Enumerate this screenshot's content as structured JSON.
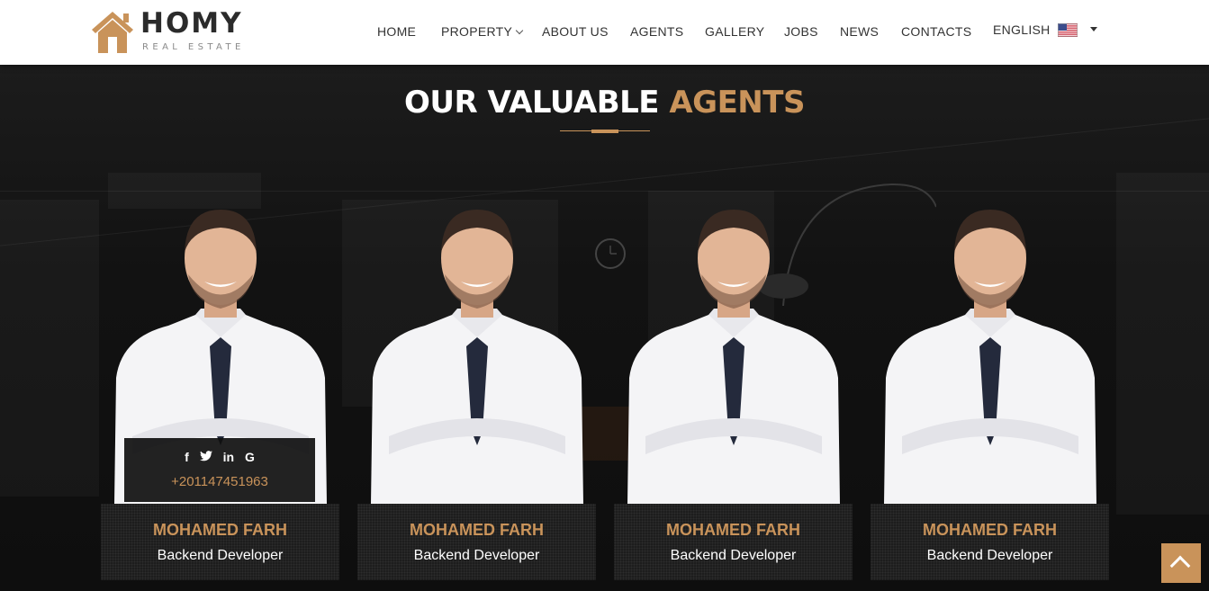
{
  "brand": {
    "name": "HOMY",
    "tagline": "REAL ESTATE",
    "colors": {
      "accent": "#c9935a",
      "dark": "#2b2b2b",
      "background": "#141414"
    }
  },
  "nav": {
    "items": [
      {
        "label": "HOME"
      },
      {
        "label": "PROPERTY",
        "has_dropdown": true
      },
      {
        "label": "ABOUT US"
      },
      {
        "label": "AGENTS"
      },
      {
        "label": "GALLERY"
      },
      {
        "label": "JOBS"
      },
      {
        "label": "NEWS"
      },
      {
        "label": "CONTACTS"
      }
    ],
    "language": {
      "label": "ENGLISH",
      "flag_icon": "us-flag-icon"
    }
  },
  "section": {
    "title_main": "OUR VALUABLE",
    "title_accent": "AGENTS"
  },
  "agents": [
    {
      "name": "MOHAMED FARH",
      "role": "Backend Developer",
      "phone": "+201147451963",
      "social": [
        "f",
        "t",
        "in",
        "G"
      ]
    },
    {
      "name": "MOHAMED FARH",
      "role": "Backend Developer"
    },
    {
      "name": "MOHAMED FARH",
      "role": "Backend Developer"
    },
    {
      "name": "MOHAMED FARH",
      "role": "Backend Developer"
    }
  ],
  "scroll_top": {
    "icon": "chevron-up-icon"
  }
}
